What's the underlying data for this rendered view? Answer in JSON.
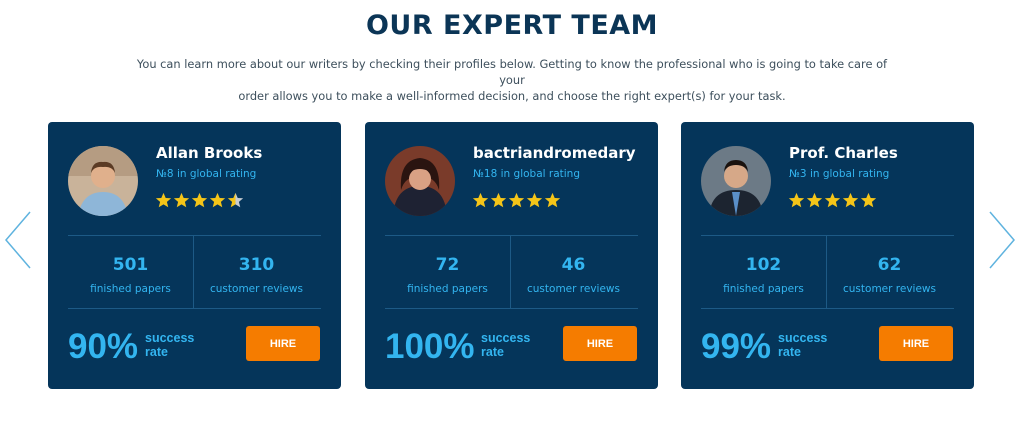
{
  "header": {
    "title": "OUR EXPERT TEAM",
    "intro_line1": "You can learn more about our writers by checking their profiles below. Getting to know the professional who is going to take care of your",
    "intro_line2": "order allows you to make a well-informed decision, and choose the right expert(s) for your task."
  },
  "colors": {
    "card_bg": "#05355a",
    "accent": "#33b5f0",
    "hire_button": "#f57c00",
    "star": "#f5c518",
    "title": "#0b3556"
  },
  "icons": {
    "left": "chevron-left-icon",
    "right": "chevron-right-icon",
    "star": "star-icon"
  },
  "experts": [
    {
      "name": "Allan Brooks",
      "rating": "№8 in global rating",
      "stars": 4.5,
      "papers": "501",
      "papers_label": "finished papers",
      "reviews": "310",
      "reviews_label": "customer reviews",
      "success": "90%",
      "success_label_1": "success",
      "success_label_2": "rate",
      "hire_label": "HIRE"
    },
    {
      "name": "bactriandromedary",
      "rating": "№18 in global rating",
      "stars": 5,
      "papers": "72",
      "papers_label": "finished papers",
      "reviews": "46",
      "reviews_label": "customer reviews",
      "success": "100%",
      "success_label_1": "success",
      "success_label_2": "rate",
      "hire_label": "HIRE"
    },
    {
      "name": "Prof. Charles",
      "rating": "№3 in global rating",
      "stars": 5,
      "papers": "102",
      "papers_label": "finished papers",
      "reviews": "62",
      "reviews_label": "customer reviews",
      "success": "99%",
      "success_label_1": "success",
      "success_label_2": "rate",
      "hire_label": "HIRE"
    }
  ]
}
